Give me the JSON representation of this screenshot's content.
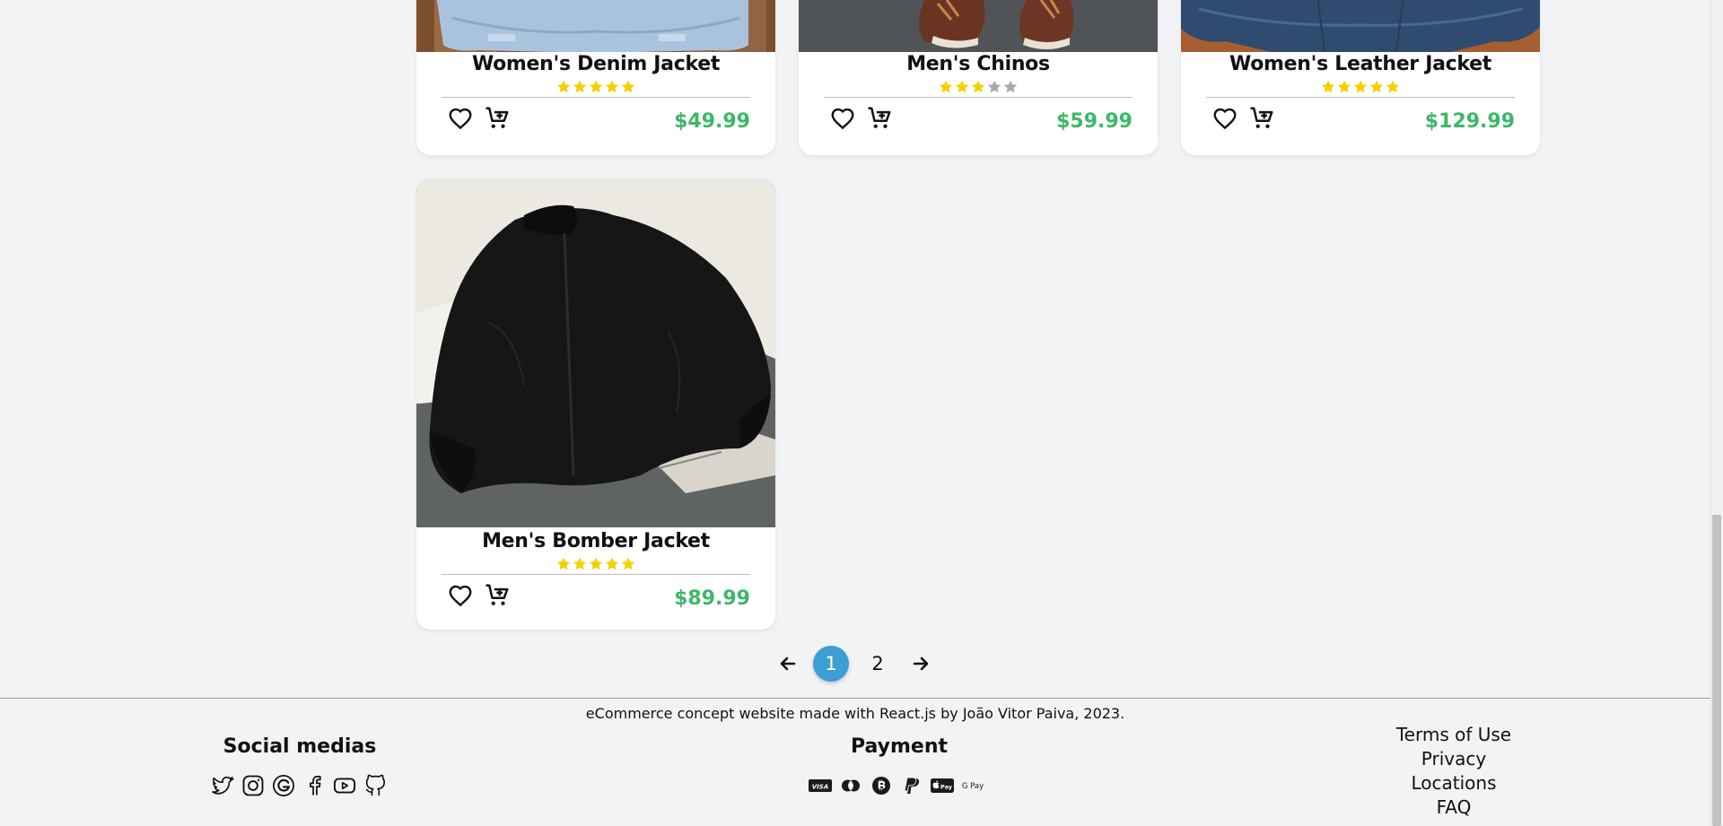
{
  "products": [
    {
      "name": "Women's Denim Jacket",
      "rating": 5,
      "price": "$49.99"
    },
    {
      "name": "Men's Chinos",
      "rating": 3,
      "price": "$59.99"
    },
    {
      "name": "Women's Leather Jacket",
      "rating": 5,
      "price": "$129.99"
    },
    {
      "name": "Men's Bomber Jacket",
      "rating": 5,
      "price": "$89.99"
    }
  ],
  "pagination": {
    "prev": "←",
    "pages": [
      "1",
      "2"
    ],
    "current_page": "1",
    "next": "→"
  },
  "footer": {
    "credit": "eCommerce concept website made with React.js by João Vitor Paiva, 2023.",
    "social_title": "Social medias",
    "social_icons": [
      "twitter-icon",
      "instagram-icon",
      "google-icon",
      "facebook-icon",
      "youtube-icon",
      "github-icon"
    ],
    "payment_title": "Payment",
    "payment_icons": [
      "visa-icon",
      "mastercard-icon",
      "bitcoin-icon",
      "paypal-icon",
      "apple-pay-icon",
      "google-pay-icon"
    ],
    "payment_labels": {
      "visa": "VISA",
      "apple_pay": "Pay",
      "google_pay": "G Pay"
    },
    "links": [
      "Terms of Use",
      "Privacy",
      "Locations",
      "FAQ"
    ]
  },
  "colors": {
    "price": "#3cb867",
    "star_filled": "#f5d000",
    "star_empty": "#a9a9a9",
    "page_active": "#3a9fd2",
    "background": "#f2f3f5"
  }
}
